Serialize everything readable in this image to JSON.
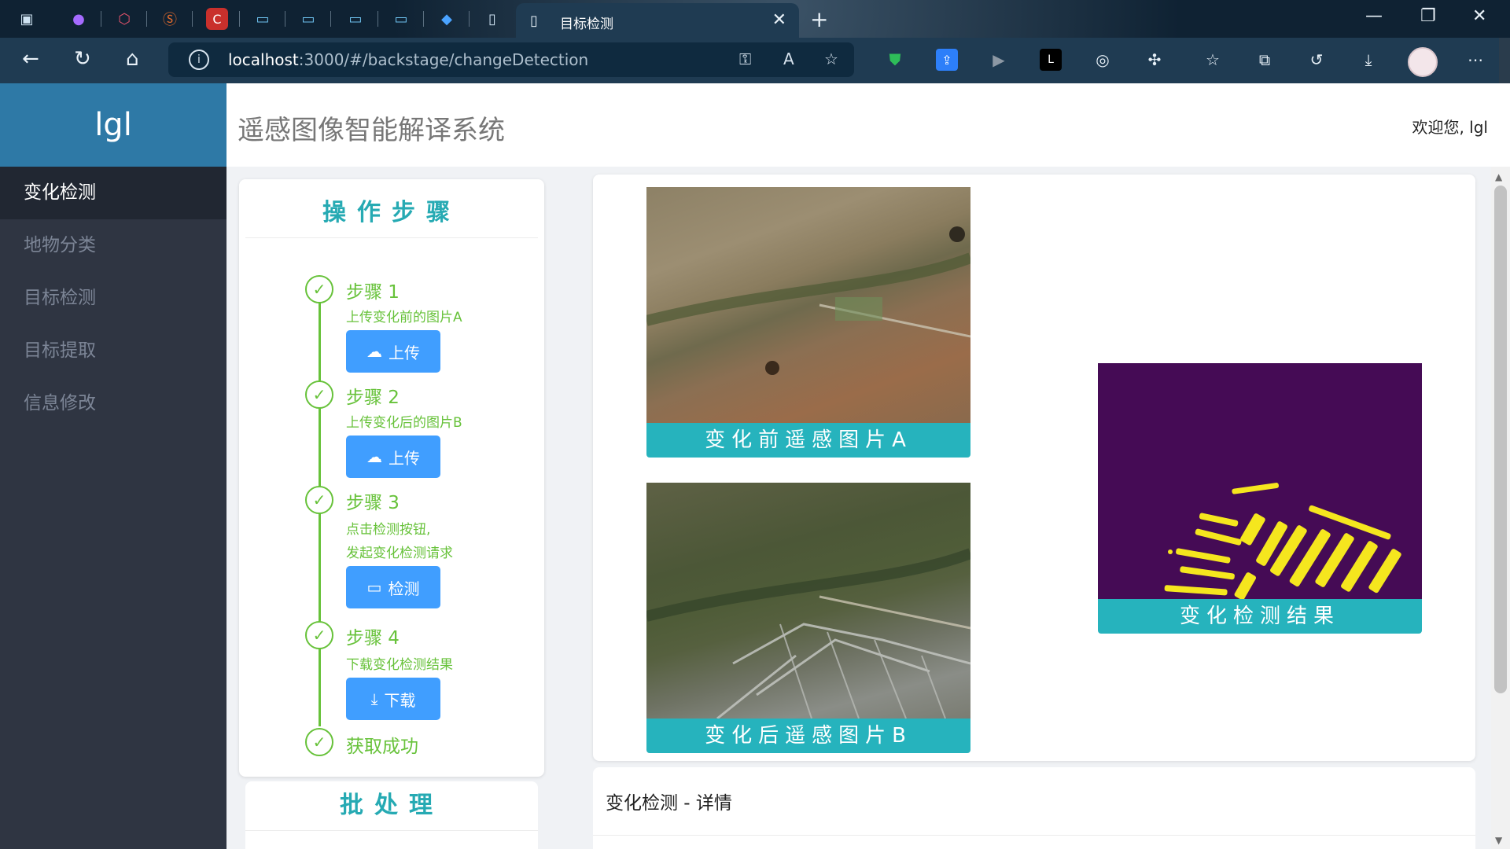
{
  "browser": {
    "active_tab_title": "目标检测",
    "url_host": "localhost",
    "url_path": ":3000/#/backstage/changeDetection"
  },
  "app": {
    "logo": "lgl",
    "title": "遥感图像智能解译系统",
    "welcome": "欢迎您, lgl"
  },
  "sidebar": {
    "items": [
      {
        "label": "变化检测",
        "active": true
      },
      {
        "label": "地物分类",
        "active": false
      },
      {
        "label": "目标检测",
        "active": false
      },
      {
        "label": "目标提取",
        "active": false
      },
      {
        "label": "信息修改",
        "active": false
      }
    ]
  },
  "steps": {
    "header": "操作步骤",
    "items": [
      {
        "title": "步骤 1",
        "desc": "上传变化前的图片A",
        "button": "上传",
        "icon": "cloud-upload-icon"
      },
      {
        "title": "步骤 2",
        "desc": "上传变化后的图片B",
        "button": "上传",
        "icon": "cloud-upload-icon"
      },
      {
        "title": "步骤 3",
        "desc_line1": "点击检测按钮,",
        "desc_line2": "发起变化检测请求",
        "button": "检测",
        "icon": "monitor-icon"
      },
      {
        "title": "步骤 4",
        "desc": "下载变化检测结果",
        "button": "下载",
        "icon": "download-icon"
      },
      {
        "title": "获取成功"
      }
    ],
    "status_color": "#67c23a",
    "button_color": "#409eff"
  },
  "batch": {
    "header": "批处理"
  },
  "images": {
    "before_caption": "变化前遥感图片A",
    "after_caption": "变化后遥感图片B",
    "result_caption": "变化检测结果",
    "caption_color": "#26b3bd",
    "result_bg_color": "#450b55",
    "result_change_color": "#f5e61e"
  },
  "detail": {
    "title": "变化检测 - 详情"
  }
}
